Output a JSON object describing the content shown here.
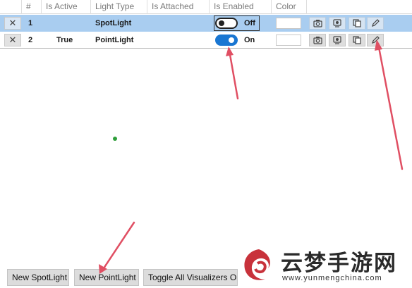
{
  "table": {
    "columns": [
      "#",
      "Is Active",
      "Light Type",
      "Is Attached",
      "Is Enabled",
      "Color"
    ],
    "rows": [
      {
        "index": "1",
        "is_active": "",
        "light_type": "SpotLight",
        "is_attached": "",
        "enabled_label": "Off",
        "enabled": false,
        "selected": true,
        "color": "#ffffff"
      },
      {
        "index": "2",
        "is_active": "True",
        "light_type": "PointLight",
        "is_attached": "",
        "enabled_label": "On",
        "enabled": true,
        "selected": false,
        "color": "#ffffff"
      }
    ],
    "row_actions": [
      "camera-icon",
      "visualizer-icon",
      "copy-icon",
      "edit-icon"
    ],
    "delete_glyph": "✕"
  },
  "buttons": {
    "new_spotlight": "New SpotLight",
    "new_pointlight": "New PointLight",
    "toggle_visualizers": "Toggle All Visualizers On"
  },
  "watermark": {
    "chinese": "云梦手游网",
    "url": "www.yunmengchina.com"
  },
  "colors": {
    "selected_row": "#a9cdf0",
    "toggle_on": "#1976d2",
    "annotation_arrow": "#e04f63",
    "viewport_dot": "#2e9e3a"
  }
}
